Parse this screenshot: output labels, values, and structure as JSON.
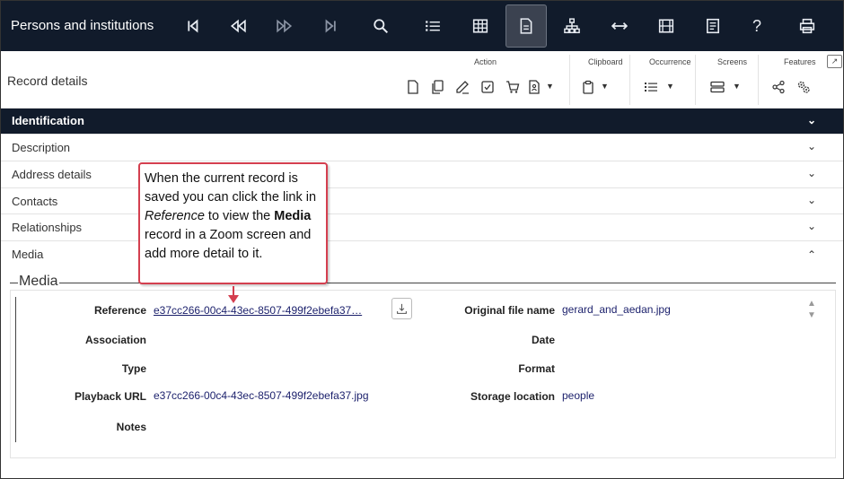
{
  "app": {
    "title": "Persons and institutions"
  },
  "topbar_icons": [
    "first-record-icon",
    "previous-record-icon",
    "next-record-icon",
    "last-record-icon",
    "search-icon",
    "list-view-icon",
    "table-view-icon",
    "record-view-icon",
    "hierarchy-icon",
    "expand-icon",
    "media-icon",
    "report-icon",
    "help-icon",
    "print-icon"
  ],
  "toolbar": {
    "title": "Record details",
    "groups": {
      "action": "Action",
      "clipboard": "Clipboard",
      "occurrence": "Occurrence",
      "screens": "Screens",
      "features": "Features"
    }
  },
  "sections": {
    "identification": "Identification",
    "description": "Description",
    "address": "Address details",
    "contacts": "Contacts",
    "relationships": "Relationships",
    "media": "Media"
  },
  "media": {
    "legend": "Media",
    "labels": {
      "reference": "Reference",
      "association": "Association",
      "type": "Type",
      "playback_url": "Playback URL",
      "notes": "Notes",
      "original_file_name": "Original file name",
      "date": "Date",
      "format": "Format",
      "storage_location": "Storage location"
    },
    "values": {
      "reference": "e37cc266-00c4-43ec-8507-499f2ebefa37…",
      "playback_url": "e37cc266-00c4-43ec-8507-499f2ebefa37.jpg",
      "original_file_name": "gerard_and_aedan.jpg",
      "storage_location": "people"
    }
  },
  "callout": {
    "part1": "When the current record is saved you can click the link in ",
    "part2": "Reference",
    "part3": " to view the ",
    "part4": "Media",
    "part5": " record in a Zoom screen and add more detail to it."
  },
  "colors": {
    "navy": "#111b2b",
    "callout_border": "#d43f4f",
    "link": "#1a1f6b"
  }
}
